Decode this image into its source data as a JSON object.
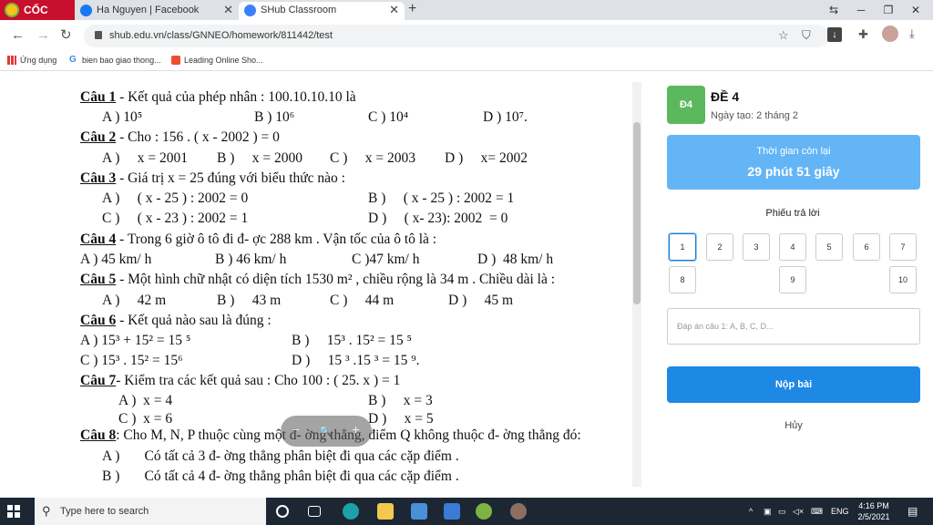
{
  "browser": {
    "brand": "CỐC CỐC",
    "tabs": [
      {
        "label": "Ha Nguyen | Facebook",
        "icon": "facebook-icon"
      },
      {
        "label": "SHub Classroom",
        "icon": "shub-icon"
      }
    ],
    "new_tab": "+",
    "url": "shub.edu.vn/class/GNNEO/homework/811442/test",
    "bookmarks": [
      "Ứng dụng",
      "bien bao giao thong...",
      "Leading Online Sho..."
    ]
  },
  "document": {
    "q1": {
      "label": "Câu 1",
      "text": " - Kết quả của phép nhân : 100.10.10.10 là",
      "a": "A ) 10⁵",
      "b": "B ) 10⁶",
      "c": "C ) 10⁴",
      "d": "D ) 10⁷."
    },
    "q2": {
      "label": "Câu 2",
      "text": " - Cho :     156 . ( x - 2002 ) = 0",
      "a": "A )     x = 2001",
      "b": "B )     x = 2000",
      "c": "C )     x = 2003",
      "d": "D )     x= 2002"
    },
    "q3": {
      "label": "Câu 3",
      "text": " -  Giá trị x = 25 đúng với biểu thức nào :",
      "a": "A )     ( x - 25 ) : 2002 = 0",
      "b": "B )     ( x - 25 ) : 2002 = 1",
      "c": "C )     ( x - 23 ) : 2002 = 1",
      "d": "D )     ( x- 23): 2002  = 0"
    },
    "q4": {
      "label": "Câu 4",
      "text": " - Trong 6 giờ ô tô đi đ- ợc 288 km . Vận tốc của ô tô là :",
      "a": "A ) 45 km/ h",
      "b": "B ) 46 km/ h",
      "c": "C )47 km/ h",
      "d": "D )  48 km/ h"
    },
    "q5": {
      "label": "Câu 5",
      "text": " - Một hình chữ nhật có diện tích 1530 m² , chiều rộng là 34 m . Chiều dài là :",
      "a": "A )     42 m",
      "b": "B )     43 m",
      "c": "C )     44 m",
      "d": "D )     45 m"
    },
    "q6": {
      "label": "Câu 6",
      "text": " - Kết quả nào sau là đúng :",
      "a": "A ) 15³ + 15² = 15 ⁵",
      "b": "B )     15³ . 15² = 15 ⁵",
      "c": "C ) 15³ . 15² = 15⁶",
      "d": "D )     15 ³ .15 ³ = 15 ⁹."
    },
    "q7": {
      "label": "Câu 7",
      "text": "- Kiểm tra các kết quả sau : Cho 100 : ( 25. x ) = 1",
      "a": "A )  x = 4",
      "b": "B )     x = 3",
      "c": "C )  x = 6",
      "d": "D )     x = 5"
    },
    "q8": {
      "label": "Câu 8",
      "text": ": Cho M, N, P thuộc cùng một đ- ờng thẳng, điểm Q không thuộc đ- ờng thẳng đó:",
      "a": "A )       Có tất cả 3 đ- ờng thẳng phân biệt đi qua các cặp điểm .",
      "b": "B )       Có tất cả 4 đ- ờng thẳng phân biệt đi qua các cặp điểm ."
    },
    "zoom": {
      "minus": "−",
      "search": "🔍",
      "plus": "+"
    }
  },
  "panel": {
    "badge": "Đ4",
    "title": "ĐỀ 4",
    "date": "Ngày tạo: 2 tháng 2",
    "timer_label": "Thời gian còn lại",
    "timer_value": "29 phút 51 giây",
    "sheet_title": "Phiếu trả lời",
    "answers": [
      "1",
      "2",
      "3",
      "4",
      "5",
      "6",
      "7",
      "8",
      "9",
      "10"
    ],
    "active_answer": "1",
    "input_placeholder": "Đáp án câu 1: A, B, C, D...",
    "submit": "Nộp bài",
    "cancel": "Hủy",
    "accent_color": "#1e88e5",
    "timer_color": "#64b5f6",
    "badge_color": "#5cb85c"
  },
  "taskbar": {
    "search_placeholder": "Type here to search",
    "lang": "ENG",
    "time": "4:16 PM",
    "date": "2/5/2021"
  }
}
